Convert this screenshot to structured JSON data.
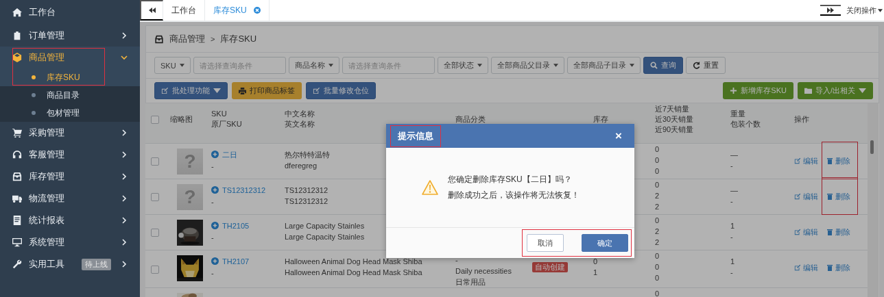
{
  "sidebar": {
    "items": [
      {
        "kind": "link",
        "label": "工作台"
      },
      {
        "kind": "group",
        "label": "订单管理",
        "expanded": false
      },
      {
        "kind": "group",
        "label": "商品管理",
        "expanded": true,
        "annotated": true,
        "children": [
          {
            "label": "库存SKU",
            "selected": true
          },
          {
            "label": "商品目录",
            "selected": false
          },
          {
            "label": "包材管理",
            "selected": false
          }
        ]
      },
      {
        "kind": "group",
        "label": "采购管理",
        "expanded": false
      },
      {
        "kind": "group",
        "label": "客服管理",
        "expanded": false
      },
      {
        "kind": "group",
        "label": "库存管理",
        "expanded": false
      },
      {
        "kind": "group",
        "label": "物流管理",
        "expanded": false
      },
      {
        "kind": "group",
        "label": "统计报表",
        "expanded": false
      },
      {
        "kind": "group",
        "label": "系统管理",
        "expanded": false
      },
      {
        "kind": "group",
        "label": "实用工具",
        "expanded": false,
        "badge": "待上线"
      }
    ]
  },
  "tab_bar": {
    "tabs": [
      {
        "label": "工作台",
        "selected": false,
        "closable": false
      },
      {
        "label": "库存SKU",
        "selected": true,
        "closable": true
      }
    ],
    "close_menu": "关闭操作"
  },
  "breadcrumb": {
    "items": [
      "商品管理",
      "库存SKU"
    ],
    "separator": ">"
  },
  "filters": [
    {
      "kind": "dropdown",
      "label": "SKU"
    },
    {
      "kind": "input",
      "placeholder": "请选择查询条件"
    },
    {
      "kind": "dropdown",
      "label": "商品名称"
    },
    {
      "kind": "input",
      "placeholder": "请选择查询条件"
    },
    {
      "kind": "dropdown",
      "label": "全部状态"
    },
    {
      "kind": "dropdown",
      "label": "全部商品父目录"
    },
    {
      "kind": "dropdown",
      "label": "全部商品子目录"
    },
    {
      "kind": "search",
      "label": "查询"
    },
    {
      "kind": "reset",
      "label": "重置"
    }
  ],
  "actions_left": [
    {
      "kind": "batch",
      "label": "批处理功能"
    },
    {
      "kind": "print",
      "label": "打印商品标签"
    },
    {
      "kind": "edit",
      "label": "批量修改仓位"
    }
  ],
  "actions_right": [
    {
      "kind": "add",
      "label": "新增库存SKU"
    },
    {
      "kind": "import",
      "label": "导入/出相关"
    }
  ],
  "table": {
    "header_checked": false,
    "columns": [
      [
        "缩略图"
      ],
      [
        "SKU",
        "原厂SKU"
      ],
      [
        "中文名称",
        "英文名称"
      ],
      [
        "商品分类"
      ],
      [],
      [
        "库存"
      ],
      [
        "近7天销量",
        "近30天销量",
        "近90天销量"
      ],
      [
        "重量",
        "包装个数"
      ],
      [
        "操作"
      ]
    ],
    "rows": [
      {
        "checked": false,
        "thumbnail": {
          "kind": "placeholder",
          "mark": "?"
        },
        "sku": "二日",
        "factory_sku": "-",
        "names": [
          "热尔特特温特",
          "dferegreg"
        ],
        "sales": [
          "0",
          "0",
          "0"
        ],
        "weight": "—",
        "pack": "-",
        "actions": [
          "编辑",
          "删除"
        ],
        "delete_annotated": true
      },
      {
        "checked": false,
        "thumbnail": {
          "kind": "placeholder",
          "mark": "?"
        },
        "sku": "TS12312312",
        "factory_sku": "-",
        "names": [
          "TS12312312",
          "TS12312312"
        ],
        "sales": [
          "0",
          "2",
          "2"
        ],
        "weight": "—",
        "pack": "-",
        "actions": [
          "编辑",
          "删除"
        ],
        "delete_annotated": true
      },
      {
        "checked": false,
        "thumbnail": {
          "kind": "picture"
        },
        "sku": "TH2105",
        "factory_sku": "-",
        "names": [
          "Large Capacity Stainles",
          "Large Capacity Stainles"
        ],
        "sales": [
          "0",
          "2",
          "2"
        ],
        "weight": "1",
        "pack": "-",
        "actions": [
          "编辑",
          "删除"
        ],
        "delete_annotated": false
      },
      {
        "checked": false,
        "thumbnail": {
          "kind": "picture"
        },
        "sku": "TH2107",
        "factory_sku": "-",
        "names": [
          "Halloween Animal Dog Head Mask Shiba",
          "Halloween Animal Dog Head Mask Shiba"
        ],
        "category": [
          "-",
          "Daily necessities",
          "日常用品"
        ],
        "status": "自动创建",
        "stock": [
          "0",
          "1"
        ],
        "sales": [
          "0",
          "0",
          "0"
        ],
        "weight": "1",
        "pack": "-",
        "actions": [
          "编辑",
          "删除"
        ],
        "delete_annotated": false
      },
      {
        "thumbnail": {
          "kind": "picture"
        },
        "sales": [
          "0"
        ]
      }
    ]
  },
  "dialog": {
    "title": "提示信息",
    "title_annotated": true,
    "close": "×",
    "messages": [
      "您确定删除库存SKU【二日】吗？",
      "删除成功之后，该操作将无法恢复！"
    ],
    "buttons_annotated": true,
    "buttons": [
      {
        "kind": "cancel",
        "label": "取消"
      },
      {
        "kind": "confirm",
        "label": "确定"
      }
    ]
  }
}
